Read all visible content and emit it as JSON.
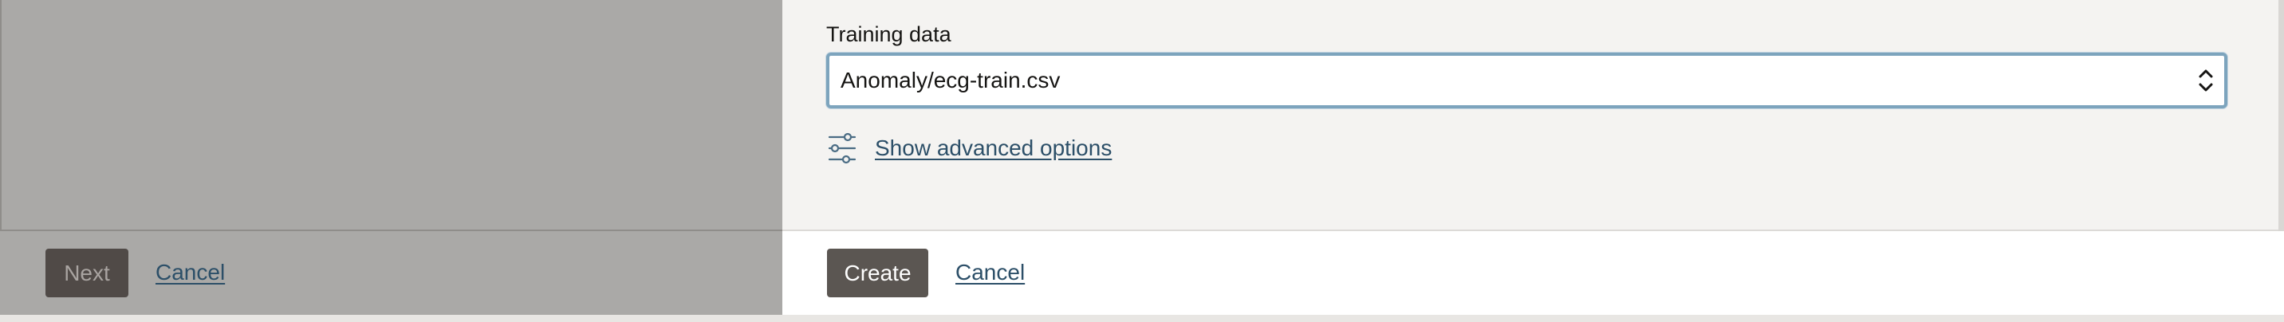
{
  "wizard_panel": {
    "footer": {
      "next_label": "Next",
      "cancel_label": "Cancel"
    }
  },
  "create_panel": {
    "training_data": {
      "label": "Training data",
      "selected_value": "Anomaly/ecg-train.csv",
      "icon": "chevron-up-down-icon"
    },
    "advanced_options": {
      "icon": "sliders-icon",
      "label": "Show advanced options"
    },
    "footer": {
      "create_label": "Create",
      "cancel_label": "Cancel"
    }
  },
  "colors": {
    "dimmed_overlay": "#aaa9a7",
    "panel_background": "#f4f3f1",
    "primary_button": "#5b5652",
    "link": "#2c4f68",
    "focus_border": "#7da4bd"
  }
}
